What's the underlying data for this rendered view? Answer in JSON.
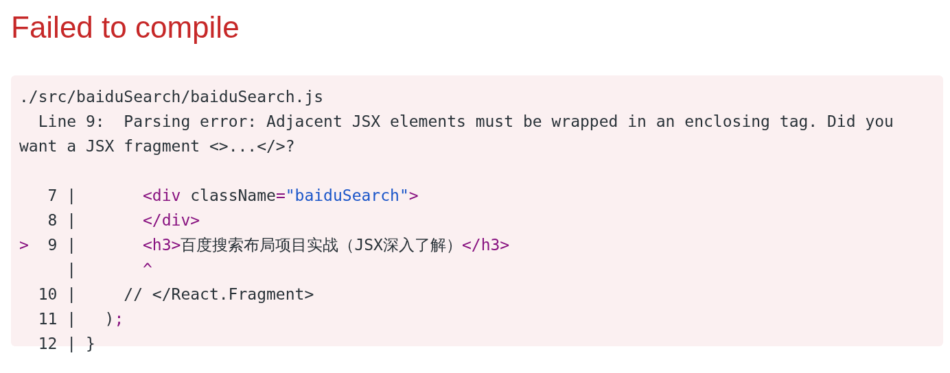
{
  "title": "Failed to compile",
  "error": {
    "file": "./src/baiduSearch/baiduSearch.js",
    "message": "  Line 9:  Parsing error: Adjacent JSX elements must be wrapped in an enclosing tag. Did you want a JSX fragment <>...</>?",
    "lines": [
      {
        "number": "7",
        "bar": "|",
        "tokens": [
          {
            "kind": "tag",
            "text": "       <div"
          },
          {
            "kind": "plain",
            "text": " className"
          },
          {
            "kind": "tag",
            "text": "="
          },
          {
            "kind": "string",
            "text": "\"baiduSearch\""
          },
          {
            "kind": "tag",
            "text": ">"
          }
        ]
      },
      {
        "number": "8",
        "bar": "|",
        "tokens": [
          {
            "kind": "tag",
            "text": "       </div>"
          }
        ]
      },
      {
        "marker": ">",
        "number": "9",
        "bar": "|",
        "tokens": [
          {
            "kind": "tag",
            "text": "       <h3>"
          },
          {
            "kind": "plain",
            "text": "百度搜索布局项目实战（JSX深入了解）"
          },
          {
            "kind": "tag",
            "text": "</h3>"
          }
        ]
      },
      {
        "bar": "|",
        "tokens": [
          {
            "kind": "tag",
            "text": "       ^"
          }
        ]
      },
      {
        "number": "10",
        "bar": "|",
        "tokens": [
          {
            "kind": "plain",
            "text": "     // </React.Fragment>"
          }
        ]
      },
      {
        "number": "11",
        "bar": "|",
        "tokens": [
          {
            "kind": "plain",
            "text": "   )"
          },
          {
            "kind": "tag",
            "text": ";"
          }
        ]
      },
      {
        "number": "12",
        "bar": "|",
        "tokens": [
          {
            "kind": "plain",
            "text": " }"
          }
        ]
      }
    ]
  }
}
